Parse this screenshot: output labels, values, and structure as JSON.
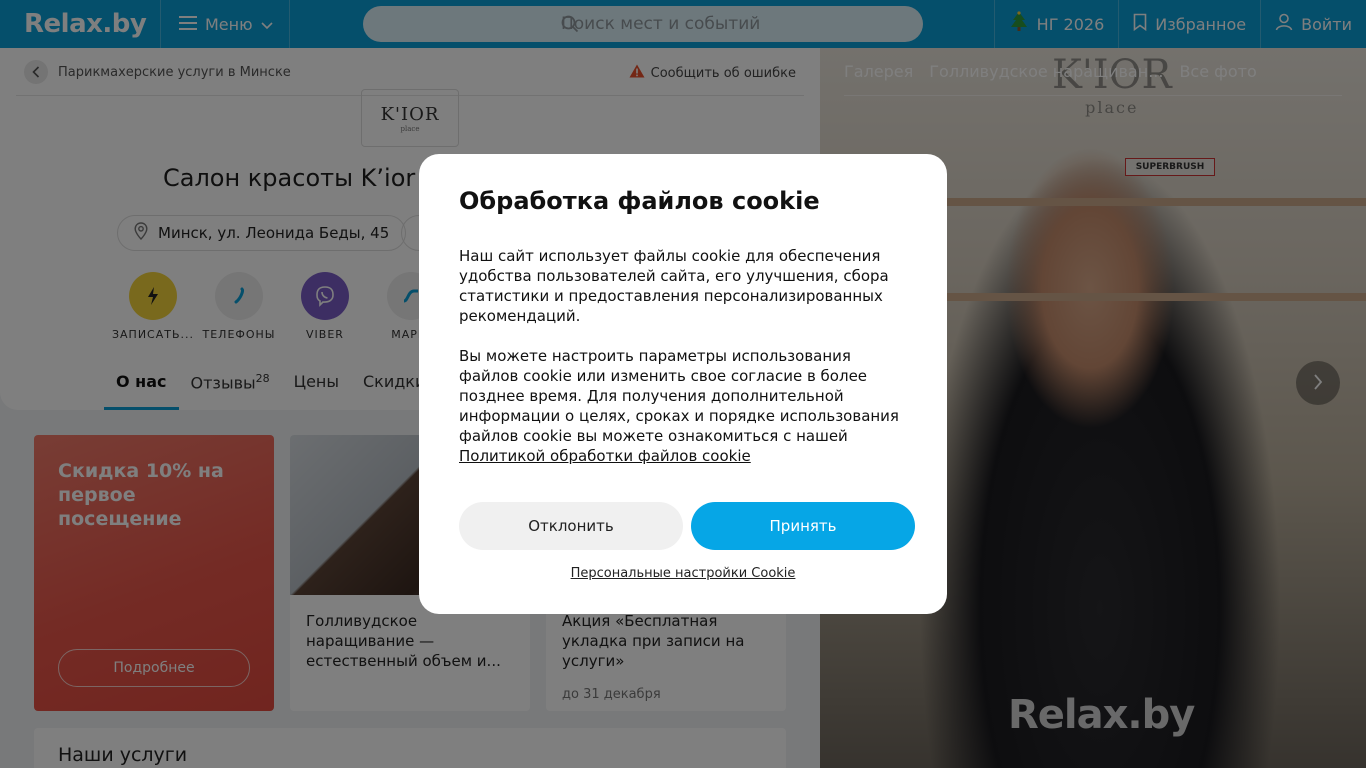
{
  "topbar": {
    "logo": "Relax.by",
    "menu_label": "Меню",
    "search_placeholder": "Поиск мест и событий",
    "ny_label": "НГ 2026",
    "favorites_label": "Избранное",
    "login_label": "Войти"
  },
  "breadcrumb": {
    "label": "Парикмахерские услуги в Минске"
  },
  "report_label": "Сообщить об ошибке",
  "salon": {
    "logo_text": "K'IOR",
    "logo_sub": "place",
    "title": "Салон красоты K’ior",
    "address": "Минск, ул. Леонида Беды, 45"
  },
  "actions": [
    {
      "label": "ЗАПИСАТЬ...",
      "icon": "booking-icon",
      "color": "#f2d23a"
    },
    {
      "label": "ТЕЛЕФОНЫ",
      "icon": "phone-icon",
      "color": "#ececec"
    },
    {
      "label": "VIBER",
      "icon": "viber-icon",
      "color": "#7b5cc7"
    },
    {
      "label": "МАРШ",
      "icon": "route-icon",
      "color": "#ececec"
    }
  ],
  "tabs": [
    {
      "label": "О нас",
      "active": true
    },
    {
      "label": "Отзывы",
      "count": "28"
    },
    {
      "label": "Цены"
    },
    {
      "label": "Скидки"
    }
  ],
  "promo": {
    "title": "Скидка 10% на первое посещение",
    "button": "Подробнее"
  },
  "cards": [
    {
      "text": "Голливудское наращивание — естественный объем и..."
    },
    {
      "text": "Акция «Бесплатная укладка при записи на услуги»",
      "date": "до 31 декабря"
    }
  ],
  "services_title": "Наши услуги",
  "gallery": {
    "tabs": [
      "Галерея",
      "Голливудское наращиван...",
      "Все фото"
    ],
    "watermark": "Relax.by",
    "shelf_label": "SUPERBRUSH",
    "brand": "K'IOR",
    "brand_sub": "place"
  },
  "cookie": {
    "title": "Обработка файлов cookie",
    "para1": "Наш сайт использует файлы cookie для обеспечения удобства пользователей сайта, его улучшения, сбора статистики и предоставления персонализированных рекомендаций.",
    "para2": "Вы можете настроить параметры использования файлов cookie или изменить свое согласие в более позднее время. Для получения дополнительной информации о целях, сроках и порядке использования файлов cookie вы можете ознакомиться с нашей ",
    "policy_link": "Политикой обработки файлов cookie",
    "decline": "Отклонить",
    "accept": "Принять",
    "personal": "Персональные настройки Cookie"
  }
}
